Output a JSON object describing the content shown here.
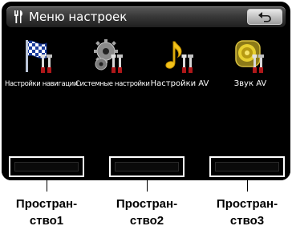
{
  "header": {
    "title": "Меню настроек",
    "back_icon": "return-arrow-icon",
    "title_icon": "settings-fork-icon"
  },
  "menu": {
    "items": [
      {
        "label": "Настройки навигации",
        "icon": "navigation-flag-icon"
      },
      {
        "label": "Системные настройки",
        "icon": "system-gear-icon"
      },
      {
        "label": "Настройки AV",
        "icon": "music-note-icon"
      },
      {
        "label": "Звук AV",
        "icon": "speaker-icon"
      }
    ]
  },
  "spaces": [
    {
      "line1": "Простран-",
      "line2": "ство1"
    },
    {
      "line1": "Простран-",
      "line2": "ство2"
    },
    {
      "line1": "Простран-",
      "line2": "ство3"
    }
  ],
  "colors": {
    "screen_bg": "#000000",
    "titlebar_top": "#5a5a5a",
    "titlebar_bottom": "#1f1f1f",
    "text": "#ffffff"
  }
}
